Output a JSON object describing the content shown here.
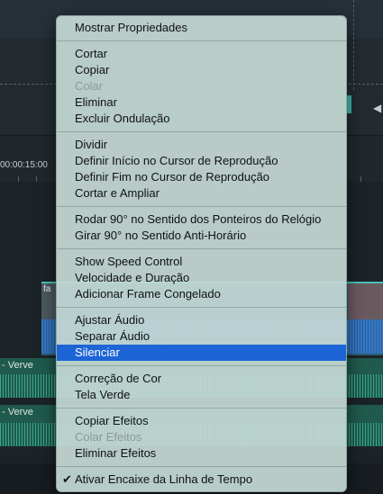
{
  "timeline": {
    "ruler_time": "00:00:15:00",
    "clip_label_left": "fa",
    "audio_tracks": [
      {
        "label": "- Verve"
      },
      {
        "label": "- Verve"
      }
    ]
  },
  "context_menu": {
    "groups": [
      [
        {
          "label": "Mostrar Propriedades",
          "enabled": true
        }
      ],
      [
        {
          "label": "Cortar",
          "enabled": true
        },
        {
          "label": "Copiar",
          "enabled": true
        },
        {
          "label": "Colar",
          "enabled": false
        },
        {
          "label": "Eliminar",
          "enabled": true
        },
        {
          "label": "Excluir Ondulação",
          "enabled": true
        }
      ],
      [
        {
          "label": "Dividir",
          "enabled": true
        },
        {
          "label": "Definir Início no Cursor de Reprodução",
          "enabled": true
        },
        {
          "label": "Definir Fim no Cursor de Reprodução",
          "enabled": true
        },
        {
          "label": "Cortar e Ampliar",
          "enabled": true
        }
      ],
      [
        {
          "label": "Rodar 90° no Sentido dos Ponteiros do Relógio",
          "enabled": true
        },
        {
          "label": "Girar 90° no Sentido Anti-Horário",
          "enabled": true
        }
      ],
      [
        {
          "label": "Show Speed Control",
          "enabled": true
        },
        {
          "label": "Velocidade e Duração",
          "enabled": true
        },
        {
          "label": "Adicionar Frame Congelado",
          "enabled": true
        }
      ],
      [
        {
          "label": "Ajustar Áudio",
          "enabled": true
        },
        {
          "label": "Separar Áudio",
          "enabled": true
        },
        {
          "label": "Silenciar",
          "enabled": true,
          "selected": true
        }
      ],
      [
        {
          "label": "Correção de Cor",
          "enabled": true
        },
        {
          "label": "Tela Verde",
          "enabled": true
        }
      ],
      [
        {
          "label": "Copiar Efeitos",
          "enabled": true
        },
        {
          "label": "Colar Efeitos",
          "enabled": false
        },
        {
          "label": "Eliminar Efeitos",
          "enabled": true
        }
      ],
      [
        {
          "label": "Ativar Encaixe da Linha de Tempo",
          "enabled": true,
          "checked": true
        }
      ]
    ],
    "check_glyph": "✔",
    "colors": {
      "selected_bg": "#1d64d6",
      "disabled_text": "#8e9a9a"
    }
  }
}
